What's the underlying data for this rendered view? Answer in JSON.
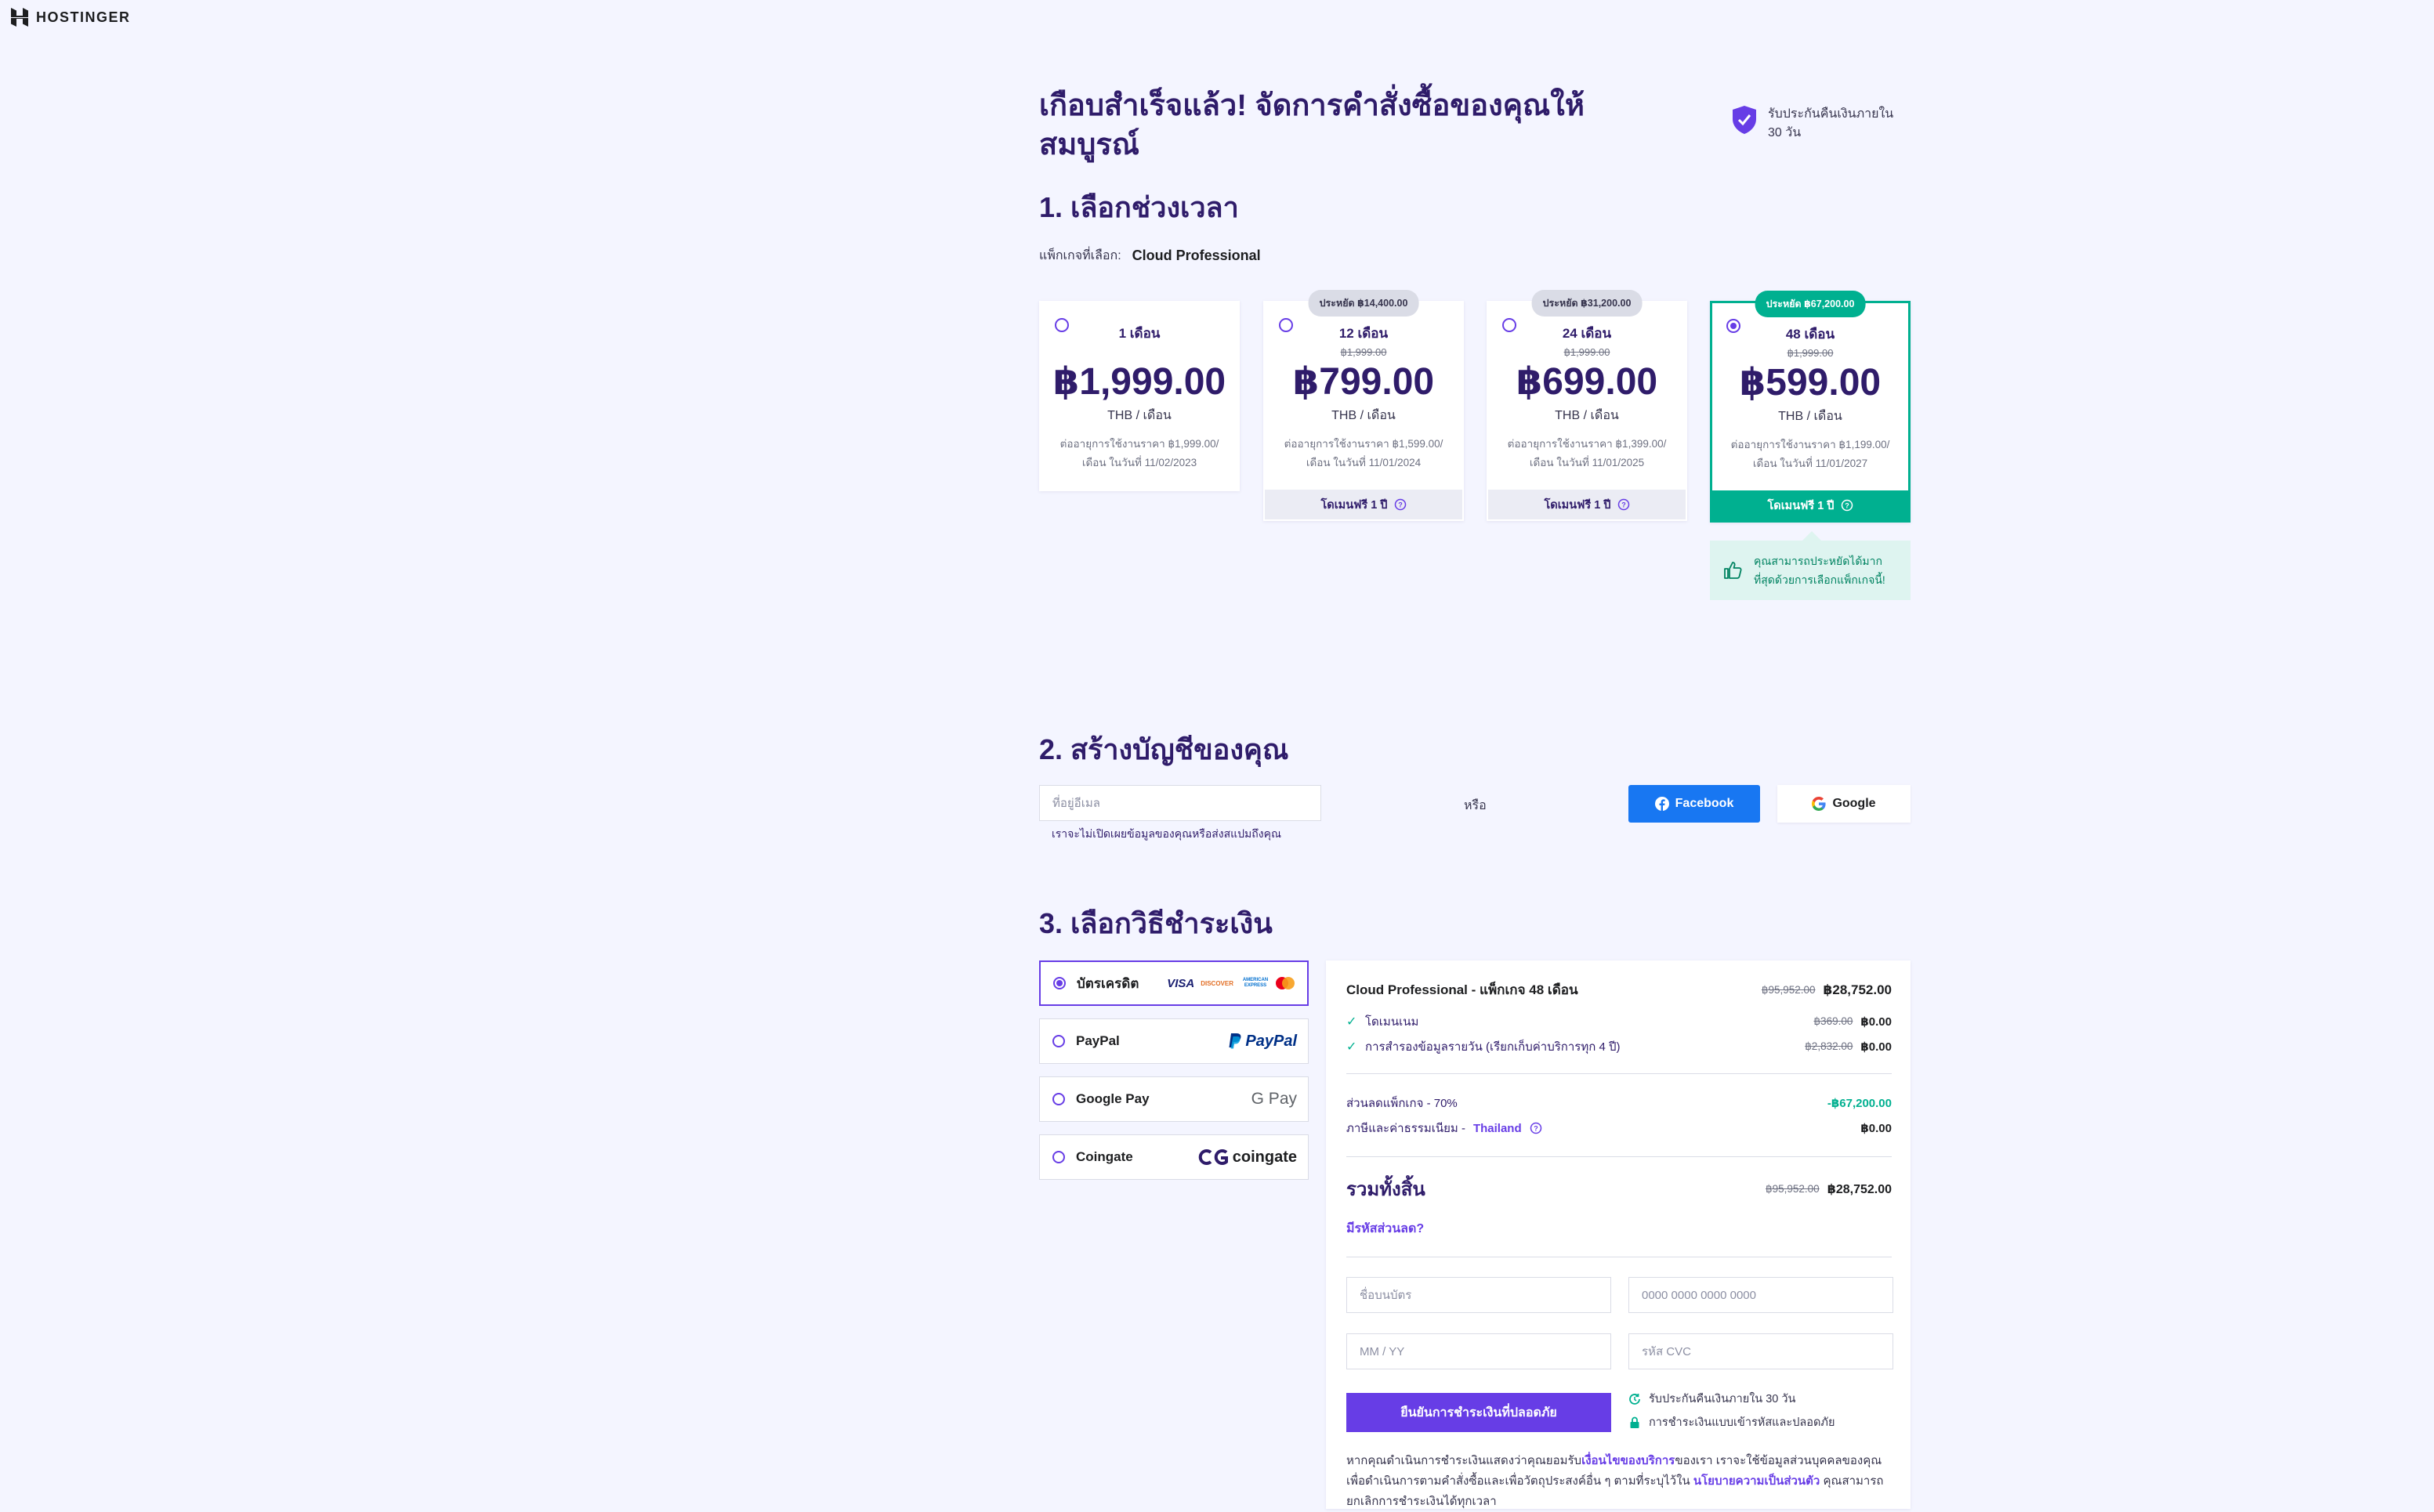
{
  "brand": {
    "name": "HOSTINGER"
  },
  "header": {
    "title": "เกือบสำเร็จแล้ว! จัดการคำสั่งซื้อของคุณให้สมบูรณ์",
    "guarantee": "รับประกันคืนเงินภายใน 30 วัน"
  },
  "step1": {
    "title": "1. เลือกช่วงเวลา",
    "package_label": "แพ็กเกจที่เลือก:",
    "package_name": "Cloud Professional",
    "tip": "คุณสามารถประหยัดได้มากที่สุดด้วยการเลือกแพ็กเกจนี้!",
    "plans": [
      {
        "period": "1 เดือน",
        "badge": "",
        "old_price": "",
        "price": "฿1,999.00",
        "per": "THB / เดือน",
        "renew": "ต่ออายุการใช้งานราคา ฿1,999.00/เดือน ในวันที่ 11/02/2023",
        "domain": "",
        "selected": false
      },
      {
        "period": "12 เดือน",
        "badge": "ประหยัด ฿14,400.00",
        "old_price": "฿1,999.00",
        "price": "฿799.00",
        "per": "THB / เดือน",
        "renew": "ต่ออายุการใช้งานราคา ฿1,599.00/เดือน ในวันที่ 11/01/2024",
        "domain": "โดเมนฟรี 1 ปี",
        "selected": false
      },
      {
        "period": "24 เดือน",
        "badge": "ประหยัด ฿31,200.00",
        "old_price": "฿1,999.00",
        "price": "฿699.00",
        "per": "THB / เดือน",
        "renew": "ต่ออายุการใช้งานราคา ฿1,399.00/เดือน ในวันที่ 11/01/2025",
        "domain": "โดเมนฟรี 1 ปี",
        "selected": false
      },
      {
        "period": "48 เดือน",
        "badge": "ประหยัด ฿67,200.00",
        "old_price": "฿1,999.00",
        "price": "฿599.00",
        "per": "THB / เดือน",
        "renew": "ต่ออายุการใช้งานราคา ฿1,199.00/เดือน ในวันที่ 11/01/2027",
        "domain": "โดเมนฟรี 1 ปี",
        "selected": true
      }
    ]
  },
  "step2": {
    "title": "2. สร้างบัญชีของคุณ",
    "email_placeholder": "ที่อยู่อีเมล",
    "privacy_note": "เราจะไม่เปิดเผยข้อมูลของคุณหรือส่งสแปมถึงคุณ",
    "or": "หรือ",
    "facebook": "Facebook",
    "google": "Google"
  },
  "step3": {
    "title": "3. เลือกวิธีชำระเงิน",
    "methods": [
      {
        "label": "บัตรเครดิต",
        "logos": [
          "VISA",
          "DISCOVER",
          "AMERICAN EXPRESS",
          "mastercard"
        ],
        "selected": true
      },
      {
        "label": "PayPal",
        "logos": [
          "PayPal"
        ],
        "selected": false
      },
      {
        "label": "Google Pay",
        "logos": [
          "G Pay"
        ],
        "selected": false
      },
      {
        "label": "Coingate",
        "logos": [
          "coingate"
        ],
        "selected": false
      }
    ]
  },
  "summary": {
    "product": "Cloud Professional - แพ็กเกจ 48 เดือน",
    "product_old": "฿95,952.00",
    "product_price": "฿28,752.00",
    "items": [
      {
        "label": "โดเมนเนม",
        "old": "฿369.00",
        "price": "฿0.00"
      },
      {
        "label": "การสำรองข้อมูลรายวัน (เรียกเก็บค่าบริการทุก 4 ปี)",
        "old": "฿2,832.00",
        "price": "฿0.00"
      }
    ],
    "discount_label": "ส่วนลดแพ็กเกจ - 70%",
    "discount_value": "-฿67,200.00",
    "tax_label": "ภาษีและค่าธรรมเนียม -",
    "tax_country": "Thailand",
    "tax_value": "฿0.00",
    "total_label": "รวมทั้งสิ้น",
    "total_old": "฿95,952.00",
    "total": "฿28,752.00",
    "coupon": "มีรหัสส่วนลด?",
    "card_name_placeholder": "ชื่อบนบัตร",
    "card_number_placeholder": "0000 0000 0000 0000",
    "expiry_placeholder": "MM / YY",
    "cvc_placeholder": "รหัส CVC",
    "pay_button": "ยืนยันการชำระเงินที่ปลอดภัย",
    "assurance_1": "รับประกันคืนเงินภายใน 30 วัน",
    "assurance_2": "การชำระเงินแบบเข้ารหัสและปลอดภัย",
    "legal_1": "หากคุณดำเนินการชำระเงินแสดงว่าคุณยอมรับ",
    "legal_terms": "เงื่อนไขของบริการ",
    "legal_2": "ของเรา เราจะใช้ข้อมูลส่วนบุคคลของคุณเพื่อดำเนินการตามคำสั่งซื้อและเพื่อวัตถุประสงค์อื่น ๆ ตามที่ระบุไว้ใน",
    "legal_policy": "นโยบายความเป็นส่วนตัว",
    "legal_3": "คุณสามารถยกเลิกการชำระเงินได้ทุกเวลา"
  },
  "colors": {
    "primary": "#673de6",
    "accent_green": "#00b090",
    "heading": "#2f1c6a",
    "background": "#f4f5ff",
    "facebook": "#1877f2"
  }
}
